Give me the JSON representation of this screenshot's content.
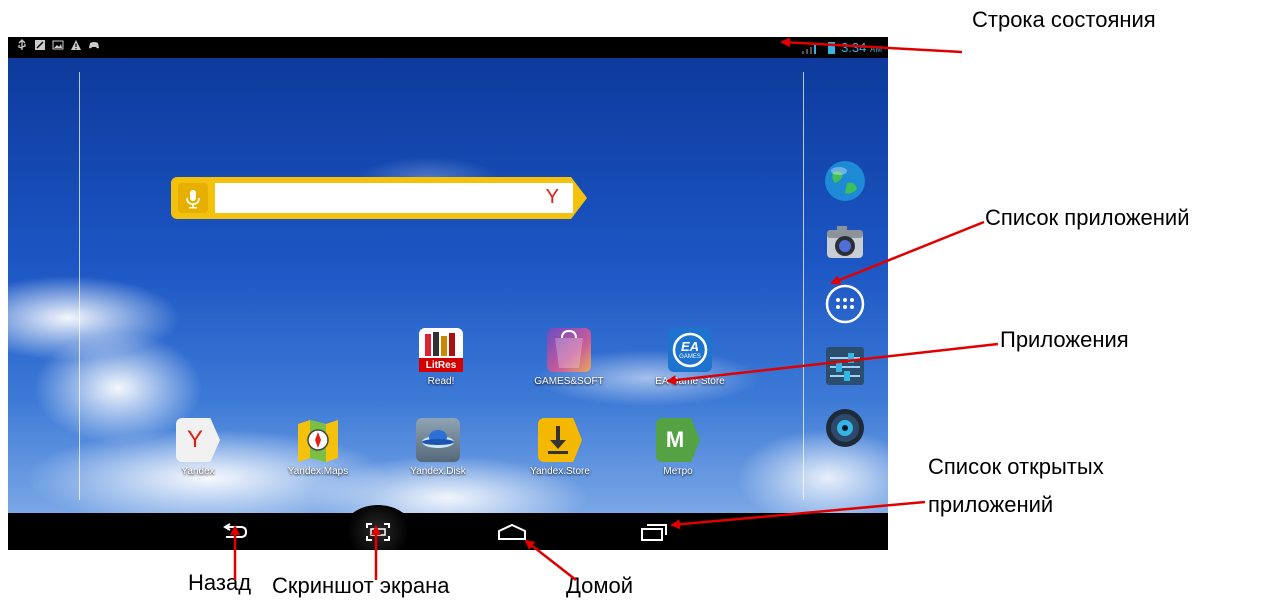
{
  "status_bar": {
    "time": "3:34",
    "ampm": "AM",
    "left_icons": [
      "usb-icon",
      "notification-icon",
      "image-icon",
      "warning-icon",
      "game-icon"
    ]
  },
  "search_widget": {
    "logo": "Y"
  },
  "apps_row1": [
    {
      "label": "Read!",
      "icon": "litres-icon",
      "badge": "LitRes"
    },
    {
      "label": "GAMES&SOFT",
      "icon": "games-soft-icon"
    },
    {
      "label": "EA Game Store",
      "icon": "ea-games-icon",
      "badge": "EA",
      "sub": "GAMES"
    }
  ],
  "apps_row2": [
    {
      "label": "Yandex",
      "icon": "yandex-icon",
      "badge": "Y"
    },
    {
      "label": "Yandex.Maps",
      "icon": "yandex-maps-icon"
    },
    {
      "label": "Yandex.Disk",
      "icon": "yandex-disk-icon"
    },
    {
      "label": "Yandex.Store",
      "icon": "yandex-store-icon"
    },
    {
      "label": "Метро",
      "icon": "metro-icon",
      "badge": "M"
    }
  ],
  "dock": [
    "browser-icon",
    "camera-icon",
    "app-drawer-icon",
    "settings-icon",
    "music-icon"
  ],
  "nav": [
    "back-icon",
    "screenshot-icon",
    "home-icon",
    "recent-apps-icon"
  ],
  "callouts": {
    "status_bar": "Строка состояния",
    "app_list": "Список приложений",
    "apps": "Приложения",
    "open_apps_1": "Список открытых",
    "open_apps_2": "приложений",
    "back": "Назад",
    "screenshot": "Скриншот экрана",
    "home": "Домой"
  },
  "colors": {
    "accent": "#34b5e5",
    "arrow": "#e00000",
    "widget": "#f4c20d"
  }
}
